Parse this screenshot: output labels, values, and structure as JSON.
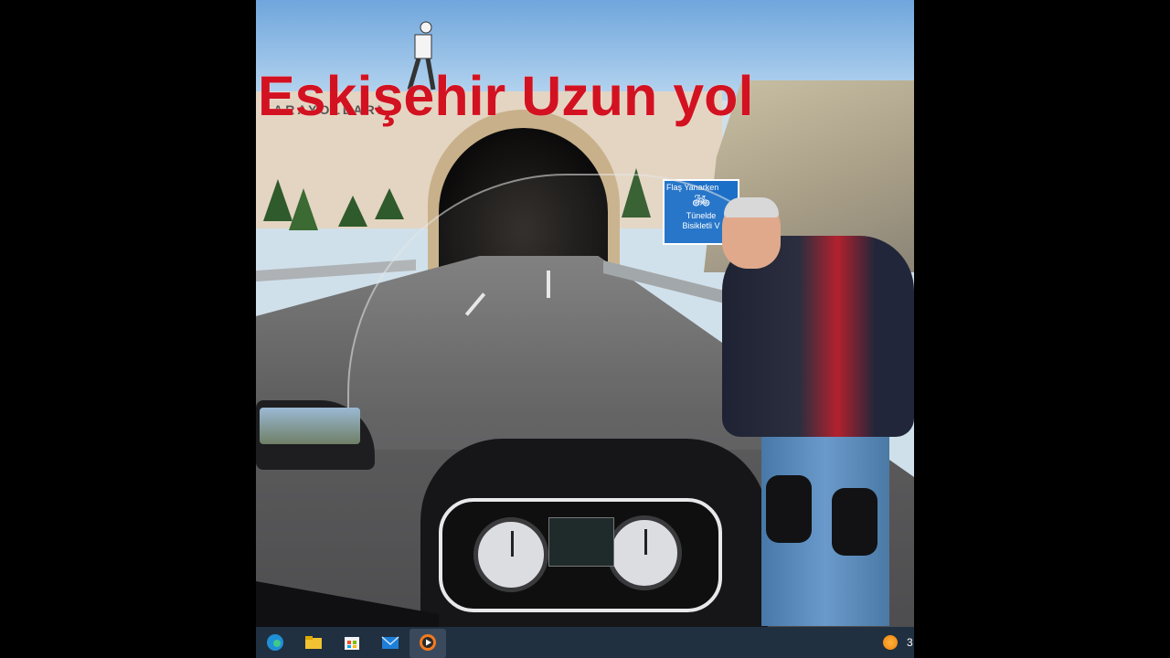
{
  "video": {
    "title_overlay": "Eskişehir Uzun yol",
    "tunnel_wall_sign": "KARAYOLLARI",
    "road_sign": {
      "line1": "Flaş Yanarken",
      "line2": "Tünelde",
      "line3": "Bisikletli V"
    },
    "colors": {
      "title": "#d31221",
      "side_bars": "#000000",
      "taskbar": "#203040"
    }
  },
  "taskbar": {
    "icons": [
      "edge-icon",
      "file-explorer-icon",
      "microsoft-store-icon",
      "mail-icon",
      "media-player-icon"
    ],
    "weather_icon": "sun-icon",
    "weather_text": "3"
  }
}
